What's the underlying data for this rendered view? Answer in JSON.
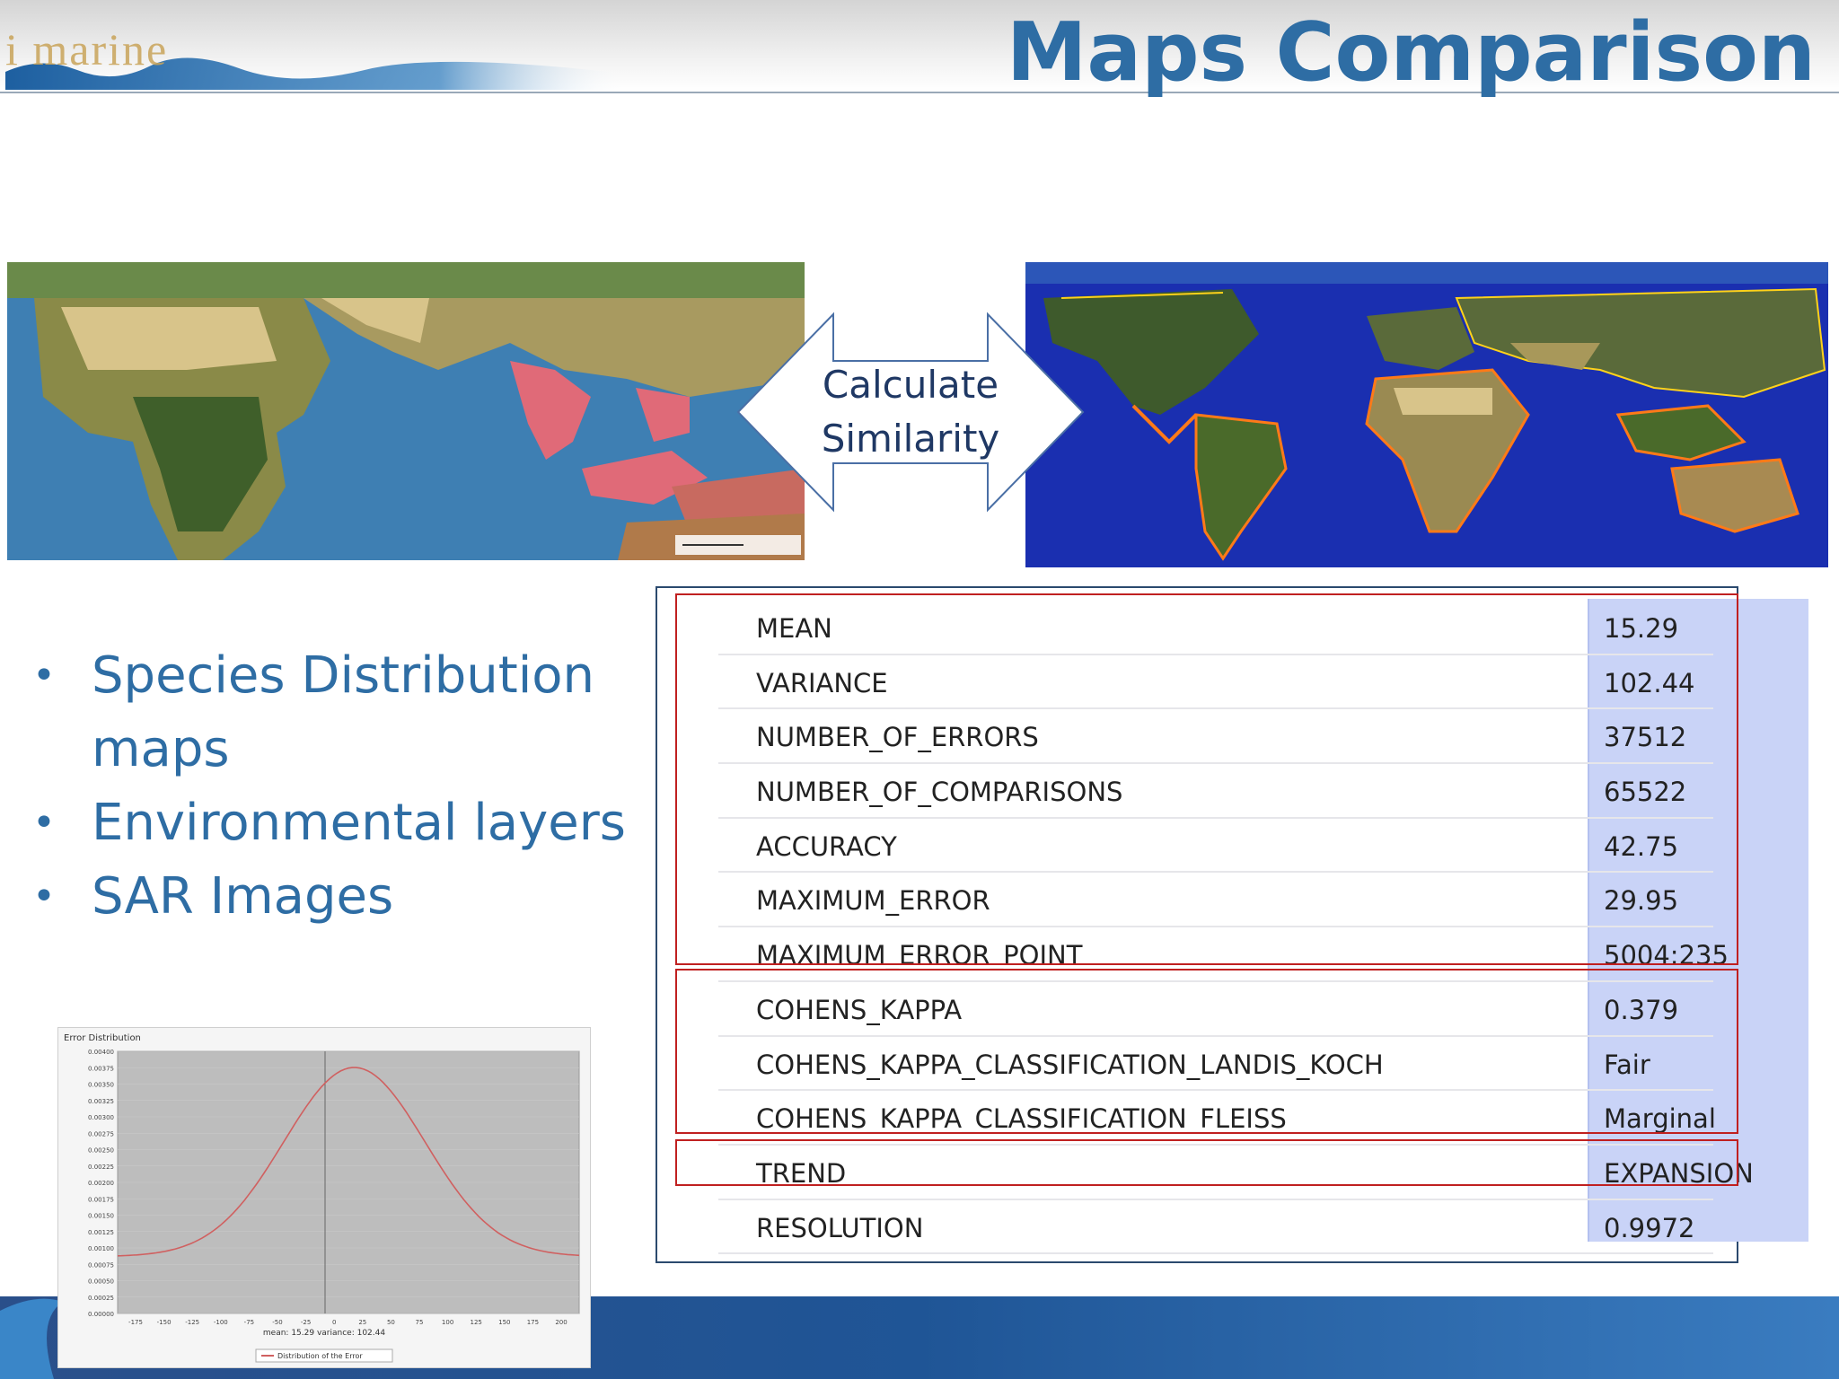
{
  "header": {
    "title": "Maps Comparison",
    "logo_text": "i marine"
  },
  "arrow": {
    "line1": "Calculate",
    "line2": "Similarity"
  },
  "bullets": [
    {
      "line1": "Species Distribution",
      "line2": "maps"
    },
    {
      "line1": "Environmental layers"
    },
    {
      "line1": "SAR Images"
    }
  ],
  "results": [
    {
      "key": "MEAN",
      "value": "15.29"
    },
    {
      "key": "VARIANCE",
      "value": "102.44"
    },
    {
      "key": "NUMBER_OF_ERRORS",
      "value": "37512"
    },
    {
      "key": "NUMBER_OF_COMPARISONS",
      "value": "65522"
    },
    {
      "key": "ACCURACY",
      "value": "42.75"
    },
    {
      "key": "MAXIMUM_ERROR",
      "value": "29.95"
    },
    {
      "key": "MAXIMUM_ERROR_POINT",
      "value": "5004:235"
    },
    {
      "key": "COHENS_KAPPA",
      "value": "0.379"
    },
    {
      "key": "COHENS_KAPPA_CLASSIFICATION_LANDIS_KOCH",
      "value": "Fair"
    },
    {
      "key": "COHENS_KAPPA_CLASSIFICATION_FLEISS",
      "value": "Marginal"
    },
    {
      "key": "TREND",
      "value": "EXPANSION"
    },
    {
      "key": "RESOLUTION",
      "value": "0.9972"
    }
  ],
  "error_chart": {
    "title": "Error Distribution",
    "stats_caption": "mean: 15.29 variance: 102.44",
    "legend": "Distribution of the Error",
    "x_ticks": [
      "-175",
      "-150",
      "-125",
      "-100",
      "-75",
      "-50",
      "-25",
      "0",
      "25",
      "50",
      "75",
      "100",
      "125",
      "150",
      "175",
      "200"
    ],
    "y_ticks": [
      "0.00400",
      "0.00375",
      "0.00350",
      "0.00325",
      "0.00300",
      "0.00275",
      "0.00250",
      "0.00225",
      "0.00200",
      "0.00175",
      "0.00150",
      "0.00125",
      "0.00100",
      "0.00075",
      "0.00050",
      "0.00025",
      "0.00000"
    ]
  },
  "colors": {
    "title": "#2e6da4",
    "bullet": "#2e6da4",
    "highlight_box": "#c02020",
    "value_column": "#c9d3f7",
    "ocean_left": "#3e7fb3",
    "ocean_right": "#1a2fb0",
    "species_area": "#e06a78"
  }
}
